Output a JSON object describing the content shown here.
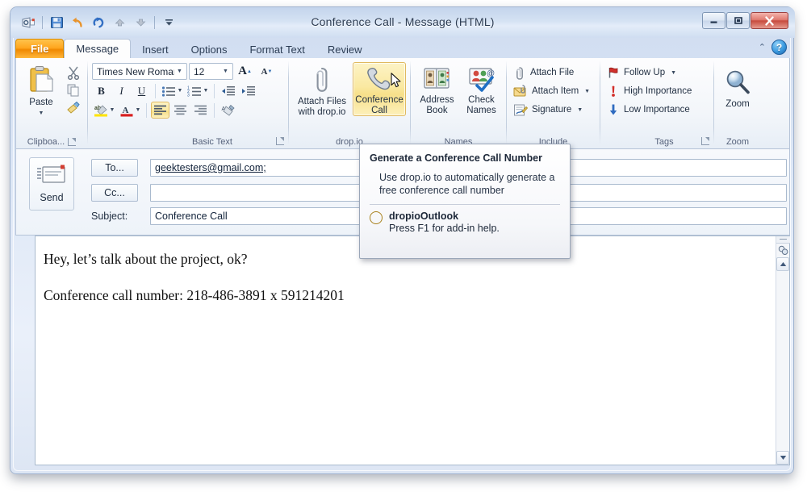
{
  "window": {
    "title": "Conference Call  -  Message (HTML)",
    "minimize_label": "–",
    "restore_label": "❐",
    "close_label": "✕"
  },
  "quick_access": {
    "items": [
      {
        "name": "outlook-icon",
        "label": ""
      },
      {
        "name": "save-icon",
        "label": ""
      },
      {
        "name": "undo-icon",
        "label": ""
      },
      {
        "name": "redo-icon",
        "label": ""
      },
      {
        "name": "previous-item-icon",
        "label": ""
      },
      {
        "name": "next-item-icon",
        "label": ""
      },
      {
        "name": "customize-qat-icon",
        "label": ""
      }
    ]
  },
  "tabs": [
    {
      "label": "File",
      "state": "file"
    },
    {
      "label": "Message",
      "state": "active"
    },
    {
      "label": "Insert",
      "state": "normal"
    },
    {
      "label": "Options",
      "state": "normal"
    },
    {
      "label": "Format Text",
      "state": "normal"
    },
    {
      "label": "Review",
      "state": "normal"
    }
  ],
  "ribbon_help": {
    "collapse_label": "⌃",
    "help_label": "?"
  },
  "ribbon": {
    "clipboard": {
      "group_label": "Clipboa...",
      "paste_label": "Paste",
      "paste_arrow": "▼",
      "cut_label": "Cut",
      "copy_label": "Copy",
      "format_painter_label": "Format Painter"
    },
    "basic_text": {
      "group_label": "Basic Text",
      "font_name": "Times New Roman",
      "font_size": "12",
      "grow_font": "A",
      "shrink_font": "A",
      "bold": "B",
      "italic": "I",
      "underline": "U",
      "bullets": "≡",
      "numbering": "≡",
      "decrease_indent": "⇤",
      "increase_indent": "⇥",
      "highlight": "ab",
      "font_color": "A",
      "align_left": "≡",
      "align_center": "≡",
      "align_right": "≡",
      "clear_formatting": "✐",
      "dropdown_caret": "▼"
    },
    "dropio": {
      "group_label": "drop.io",
      "attach_files_line1": "Attach Files",
      "attach_files_line2": "with drop.io",
      "conference_line1": "Conference",
      "conference_line2": "Call"
    },
    "names": {
      "group_label": "Names",
      "address_book_line1": "Address",
      "address_book_line2": "Book",
      "check_names_line1": "Check",
      "check_names_line2": "Names"
    },
    "include": {
      "group_label": "Include",
      "items": [
        {
          "label": "Attach File",
          "caret": ""
        },
        {
          "label": "Attach Item",
          "caret": "▼"
        },
        {
          "label": "Signature",
          "caret": "▼"
        }
      ]
    },
    "tags": {
      "group_label": "Tags",
      "items": [
        {
          "label": "Follow Up",
          "caret": "▼"
        },
        {
          "label": "High Importance",
          "caret": ""
        },
        {
          "label": "Low Importance",
          "caret": ""
        }
      ]
    },
    "zoom": {
      "group_label": "Zoom",
      "button_label": "Zoom"
    }
  },
  "compose": {
    "send_label": "Send",
    "to_button": "To...",
    "cc_button": "Cc...",
    "subject_label": "Subject:",
    "to_value": "geektesters@gmail.com;",
    "cc_value": "",
    "subject_value": "Conference Call"
  },
  "message_body": {
    "line1": "Hey, let’s talk about the project, ok?",
    "line2": "Conference call number:  218-486-3891 x 591214201"
  },
  "tooltip": {
    "title": "Generate a Conference Call Number",
    "description": "Use drop.io to automatically generate a free conference call number",
    "addin_name": "dropioOutlook",
    "addin_help": "Press F1 for add-in help."
  },
  "scrollbar": {
    "up_arrow": "▲",
    "down_arrow": "▼",
    "select_browse_object": "◉"
  },
  "colors": {
    "accent_orange": "#f08800",
    "highlight_gold": "#fae9a2",
    "frame_blue": "#cfdcf0",
    "close_red": "#c74b3e"
  }
}
